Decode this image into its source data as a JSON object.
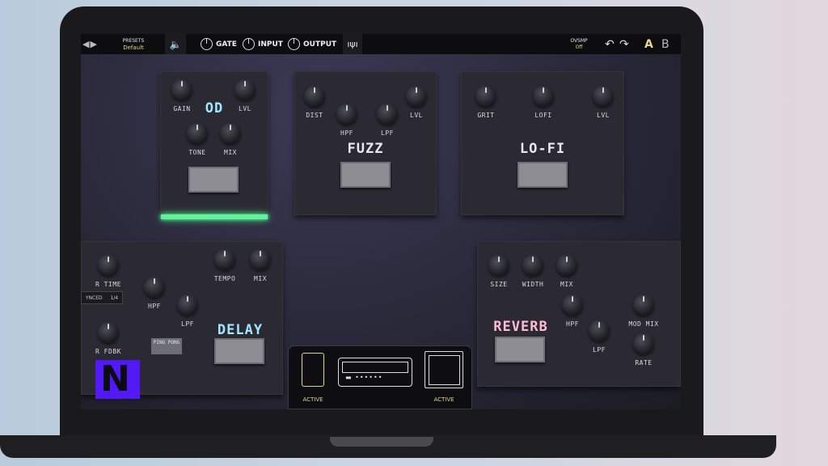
{
  "topbar": {
    "nav_arrows": "◀▶",
    "presets_label": "PRESETS",
    "preset_value": "Default",
    "speaker_icon": "speaker-icon",
    "gate_label": "GATE",
    "input_label": "INPUT",
    "output_label": "OUTPUT",
    "tuner_icon": "tuner-icon",
    "ovsmp_label": "OVSMP",
    "ovsmp_value": "Off",
    "undo": "↶",
    "redo": "↷",
    "a_label": "A",
    "b_label": "B"
  },
  "pedals": {
    "od": {
      "name": "OD",
      "knobs": [
        "GAIN",
        "LVL",
        "TONE",
        "MIX"
      ],
      "active": true
    },
    "fuzz": {
      "name": "FUZZ",
      "knobs": [
        "DIST",
        "LVL",
        "HPF",
        "LPF"
      ]
    },
    "lofi": {
      "name": "LO-FI",
      "knobs": [
        "GRIT",
        "LOFI",
        "LVL"
      ]
    },
    "delay": {
      "name": "DELAY",
      "knobs": [
        "R TIME",
        "TEMPO",
        "MIX",
        "HPF",
        "LPF",
        "R FDBK"
      ],
      "synced_label": "YNCED",
      "synced_value": "1/4",
      "pingpong": "PING PONG"
    },
    "reverb": {
      "name": "REVERB",
      "knobs": [
        "SIZE",
        "WIDTH",
        "MIX",
        "HPF",
        "MOD MIX",
        "LPF",
        "RATE"
      ]
    }
  },
  "chain": {
    "pedal_status": "ACTIVE",
    "cab_status": "ACTIVE"
  },
  "colors": {
    "accent": "#e3d48c",
    "glow": "#5ef59a",
    "logo": "#5218f5"
  }
}
